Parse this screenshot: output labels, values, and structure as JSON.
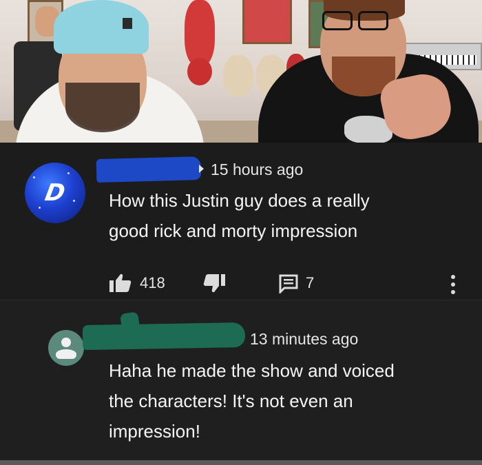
{
  "comments": [
    {
      "timestamp": "15 hours ago",
      "text_line1": "How this Justin guy does a really",
      "text_line2": "good rick and morty impression",
      "likes": "418",
      "replies": "7",
      "avatar_letter": "D"
    },
    {
      "timestamp": "13 minutes ago",
      "text_line1": "Haha he made the show and voiced",
      "text_line2": "the characters! It's not even an",
      "text_line3": "impression!"
    }
  ],
  "icons": {
    "like": "thumbs-up-icon",
    "dislike": "thumbs-down-icon",
    "reply": "comment-icon",
    "more": "more-vert-icon",
    "avatar_default": "default-avatar-icon"
  },
  "colors": {
    "background": "#1c1c1c",
    "text": "#f1f1f1",
    "redaction_blue": "#1e49c6",
    "redaction_green": "#1d6b53"
  }
}
